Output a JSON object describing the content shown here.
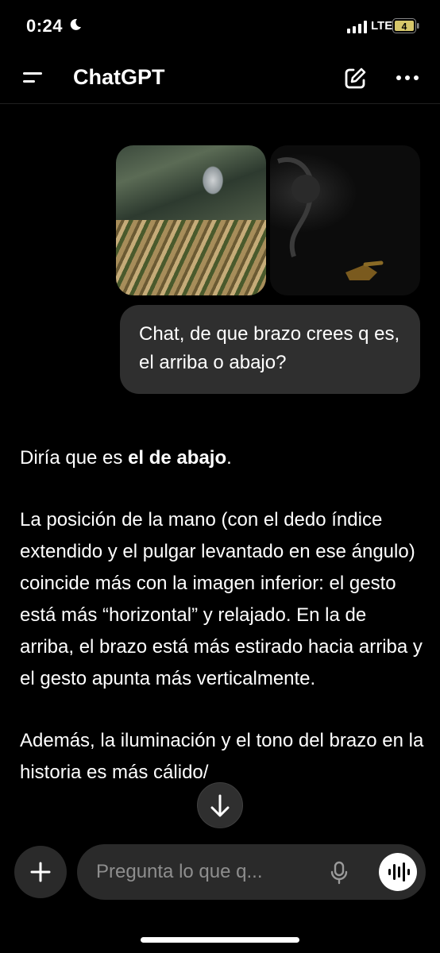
{
  "status_bar": {
    "time": "0:24",
    "network": "LTE",
    "battery": "4"
  },
  "header": {
    "title": "ChatGPT"
  },
  "user_message": {
    "text": "Chat, de que brazo crees q es, el arriba o abajo?"
  },
  "assistant_message": {
    "p1_start": "Diría que es ",
    "p1_bold": "el de abajo",
    "p1_end": ".",
    "p2": "La posición de la mano (con el dedo índice extendido y el pulgar levantado en ese ángulo) coincide más con la imagen inferior: el gesto está más “horizontal” y relajado. En la de arriba, el brazo está más estirado hacia arriba y el gesto apunta más verticalmente.",
    "p3": "Además, la iluminación y el tono del brazo en la historia es más cálido/"
  },
  "composer": {
    "placeholder": "Pregunta lo que q..."
  },
  "icons": [
    "moon-icon",
    "signal-icon",
    "battery-icon",
    "menu-icon",
    "compose-icon",
    "more-icon",
    "arrow-down-icon",
    "plus-icon",
    "mic-icon",
    "voice-mode-icon"
  ]
}
